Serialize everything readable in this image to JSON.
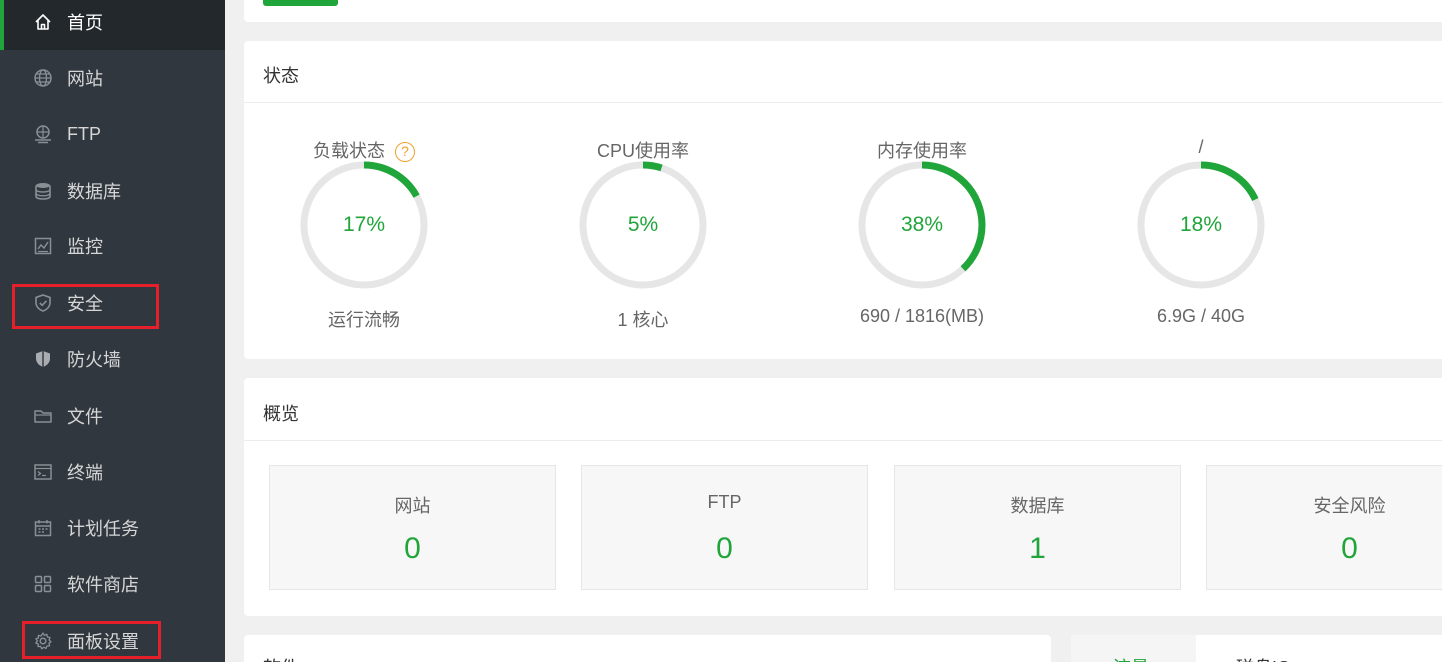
{
  "sidebar": {
    "items": [
      {
        "label": "首页",
        "icon": "home-icon"
      },
      {
        "label": "网站",
        "icon": "globe-icon"
      },
      {
        "label": "FTP",
        "icon": "ftp-icon"
      },
      {
        "label": "数据库",
        "icon": "database-icon"
      },
      {
        "label": "监控",
        "icon": "monitor-icon"
      },
      {
        "label": "安全",
        "icon": "shield-check-icon"
      },
      {
        "label": "防火墙",
        "icon": "firewall-shield-icon"
      },
      {
        "label": "文件",
        "icon": "folder-icon"
      },
      {
        "label": "终端",
        "icon": "terminal-icon"
      },
      {
        "label": "计划任务",
        "icon": "calendar-icon"
      },
      {
        "label": "软件商店",
        "icon": "grid-icon"
      },
      {
        "label": "面板设置",
        "icon": "gear-icon"
      }
    ],
    "active_index": 0,
    "highlighted_items": [
      "安全",
      "面板设置"
    ]
  },
  "status": {
    "title": "状态",
    "gauges": [
      {
        "title": "负载状态",
        "value": "17%",
        "percent": 17,
        "sub": "运行流畅",
        "help": "?"
      },
      {
        "title": "CPU使用率",
        "value": "5%",
        "percent": 5,
        "sub": "1 核心"
      },
      {
        "title": "内存使用率",
        "value": "38%",
        "percent": 38,
        "sub": "690 / 1816(MB)"
      },
      {
        "title": "/",
        "value": "18%",
        "percent": 18,
        "sub": "6.9G / 40G"
      }
    ]
  },
  "overview": {
    "title": "概览",
    "cards": [
      {
        "label": "网站",
        "value": "0"
      },
      {
        "label": "FTP",
        "value": "0"
      },
      {
        "label": "数据库",
        "value": "1"
      },
      {
        "label": "安全风险",
        "value": "0"
      }
    ]
  },
  "bottom": {
    "software_title": "软件",
    "tabs": [
      "流量",
      "磁盘IO"
    ]
  },
  "colors": {
    "accent": "#20a53a",
    "sidebar_bg": "#30373e",
    "highlight_box": "#e5202a",
    "help_icon": "#f0a030"
  }
}
